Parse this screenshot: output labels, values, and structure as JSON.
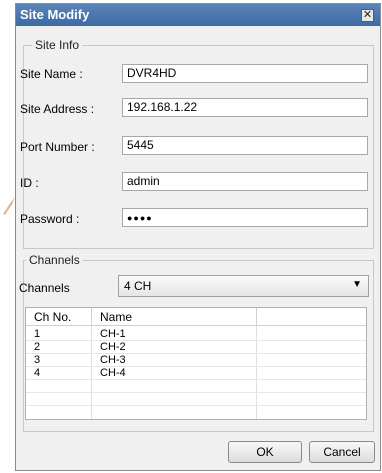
{
  "dialog": {
    "title": "Site Modify",
    "close_icon": "close-icon",
    "colors": {
      "titlebar": "#4a78ae",
      "background": "#f0f0f0"
    }
  },
  "site_info": {
    "legend": "Site Info",
    "site_name": {
      "label": "Site Name :",
      "value": "DVR4HD"
    },
    "site_address": {
      "label": "Site Address :",
      "value": "192.168.1.22"
    },
    "port_number": {
      "label": "Port Number :",
      "value": "5445"
    },
    "id": {
      "label": "ID :",
      "value": "admin"
    },
    "password": {
      "label": "Password :",
      "value": "●●●●"
    }
  },
  "channels": {
    "legend": "Channels",
    "label": "Channels",
    "selected": "4 CH",
    "table": {
      "headers": [
        "Ch No.",
        "Name"
      ],
      "rows": [
        {
          "no": "1",
          "name": "CH-1"
        },
        {
          "no": "2",
          "name": "CH-2"
        },
        {
          "no": "3",
          "name": "CH-3"
        },
        {
          "no": "4",
          "name": "CH-4"
        }
      ]
    }
  },
  "buttons": {
    "ok": "OK",
    "cancel": "Cancel"
  }
}
